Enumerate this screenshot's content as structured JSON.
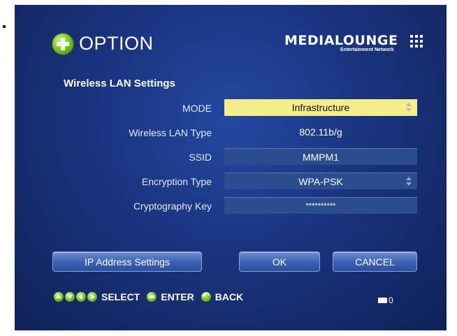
{
  "header": {
    "title": "OPTION",
    "logo_text": "MEDIALOUNGE",
    "logo_sub": "Entertainment Network"
  },
  "section_title": "Wireless LAN Settings",
  "settings": [
    {
      "label": "MODE",
      "value": "Infrastructure"
    },
    {
      "label": "Wireless LAN Type",
      "value": "802.11b/g"
    },
    {
      "label": "SSID",
      "value": "MMPM1"
    },
    {
      "label": "Encryption Type",
      "value": "WPA-PSK"
    },
    {
      "label": "Cryptography Key",
      "value": "**********"
    }
  ],
  "buttons": {
    "ip": "IP Address Settings",
    "ok": "OK",
    "cancel": "CANCEL"
  },
  "footer": {
    "select": "SELECT",
    "enter": "ENTER",
    "back": "BACK",
    "count": "0"
  },
  "colors": {
    "accent_selected": "#f4ee8a",
    "icon_green": "#6ebd22",
    "background": "#19347f"
  }
}
